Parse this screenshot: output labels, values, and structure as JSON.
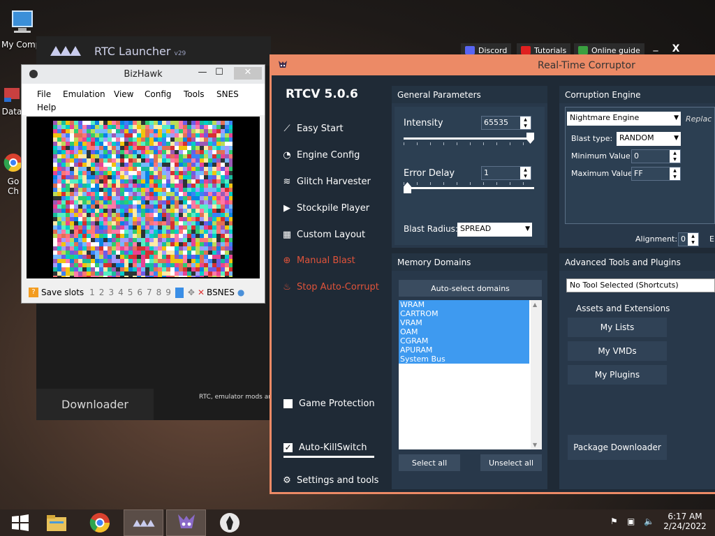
{
  "desktop": {
    "icons": [
      {
        "label": "My Comp",
        "icon": "computer-icon"
      },
      {
        "label": "Data",
        "icon": "folder-shortcut-icon"
      },
      {
        "label": "Go Ch",
        "icon": "chrome-icon"
      }
    ]
  },
  "launcher": {
    "title": "RTC Launcher",
    "version": "v29",
    "top_links": [
      {
        "label": "Discord",
        "color": "#5865F2"
      },
      {
        "label": "Tutorials",
        "color": "#e02020"
      },
      {
        "label": "Online guide",
        "color": "#3aa040"
      }
    ],
    "minimize": "_",
    "close": "X",
    "downloader": "Downloader",
    "info_text": "RTC, emulator mods an"
  },
  "bizhawk": {
    "title": "BizHawk",
    "minimize": "—",
    "maximize": "☐",
    "close": "✕",
    "menu": [
      "File",
      "Emulation",
      "View",
      "Config",
      "Tools",
      "SNES",
      "Help"
    ],
    "status": {
      "save_slots_label": "Save slots",
      "slots": [
        "1",
        "2",
        "3",
        "4",
        "5",
        "6",
        "7",
        "8",
        "9"
      ],
      "core": "BSNES"
    }
  },
  "rtcv": {
    "window_title": "Real-Time Corruptor",
    "version": "RTCV 5.0.6",
    "nav": [
      {
        "label": "Easy Start",
        "icon": "wand-icon",
        "state": "normal"
      },
      {
        "label": "Engine Config",
        "icon": "gauge-icon",
        "state": "normal"
      },
      {
        "label": "Glitch Harvester",
        "icon": "layers-icon",
        "state": "normal"
      },
      {
        "label": "Stockpile Player",
        "icon": "play-icon",
        "state": "normal"
      },
      {
        "label": "Custom Layout",
        "icon": "grid-icon",
        "state": "normal"
      },
      {
        "label": "Manual Blast",
        "icon": "crosshair-icon",
        "state": "active"
      },
      {
        "label": "Stop Auto-Corrupt",
        "icon": "flame-icon",
        "state": "active"
      }
    ],
    "game_protection": {
      "label": "Game Protection",
      "checked": false
    },
    "auto_killswitch": {
      "label": "Auto-KillSwitch",
      "checked": true
    },
    "settings": {
      "label": "Settings and tools",
      "icon": "gear-icon"
    },
    "general": {
      "title": "General Parameters",
      "intensity_label": "Intensity",
      "intensity_value": "65535",
      "intensity_fraction": 1.0,
      "error_delay_label": "Error Delay",
      "error_delay_value": "1",
      "error_delay_fraction": 0.0,
      "blast_radius_label": "Blast Radius:",
      "blast_radius_value": "SPREAD"
    },
    "engine": {
      "title": "Corruption Engine",
      "engine_value": "Nightmare Engine",
      "replace_label": "Replac",
      "blast_type_label": "Blast type:",
      "blast_type_value": "RANDOM",
      "min_label": "Minimum Value",
      "min_value": "0",
      "max_label": "Maximum Value",
      "max_value": "FF",
      "alignment_label": "Alignment:",
      "alignment_value": "0",
      "alignment_suffix": "E"
    },
    "memory": {
      "title": "Memory Domains",
      "auto_select": "Auto-select domains",
      "domains": [
        "WRAM",
        "CARTROM",
        "VRAM",
        "OAM",
        "CGRAM",
        "APURAM",
        "System Bus"
      ],
      "select_all": "Select all",
      "unselect_all": "Unselect all"
    },
    "advanced": {
      "title": "Advanced Tools and Plugins",
      "tool_select": "No Tool Selected (Shortcuts)",
      "assets_label": "Assets and Extensions",
      "buttons": [
        "My Lists",
        "My VMDs",
        "My Plugins"
      ],
      "package_downloader": "Package Downloader"
    }
  },
  "taskbar": {
    "items": [
      {
        "icon": "windows-start-icon",
        "active": false
      },
      {
        "icon": "file-explorer-icon",
        "active": false
      },
      {
        "icon": "chrome-icon",
        "active": false
      },
      {
        "icon": "rtc-launcher-icon",
        "active": true
      },
      {
        "icon": "rtcv-icon",
        "active": true
      },
      {
        "icon": "bizhawk-icon",
        "active": false
      }
    ],
    "time": "6:17 AM",
    "date": "2/24/2022"
  }
}
